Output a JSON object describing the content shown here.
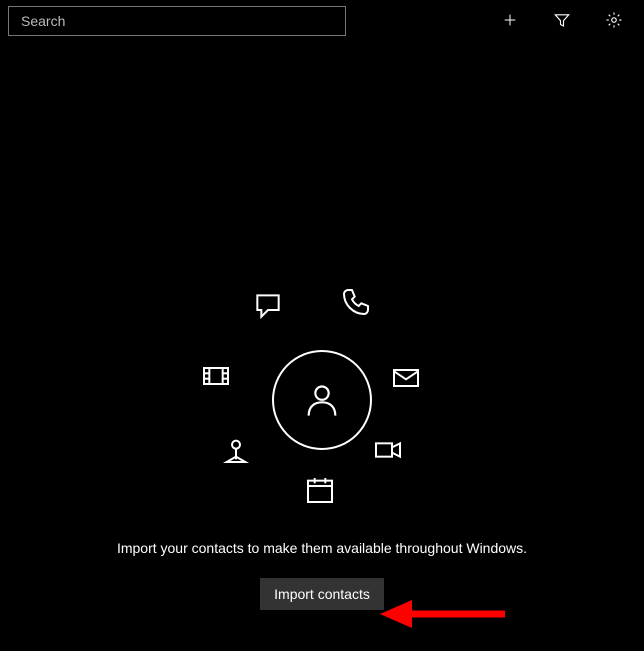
{
  "search": {
    "placeholder": "Search"
  },
  "hero": {
    "subtext": "Import your contacts to make them available throughout Windows.",
    "import_button": "Import contacts"
  }
}
